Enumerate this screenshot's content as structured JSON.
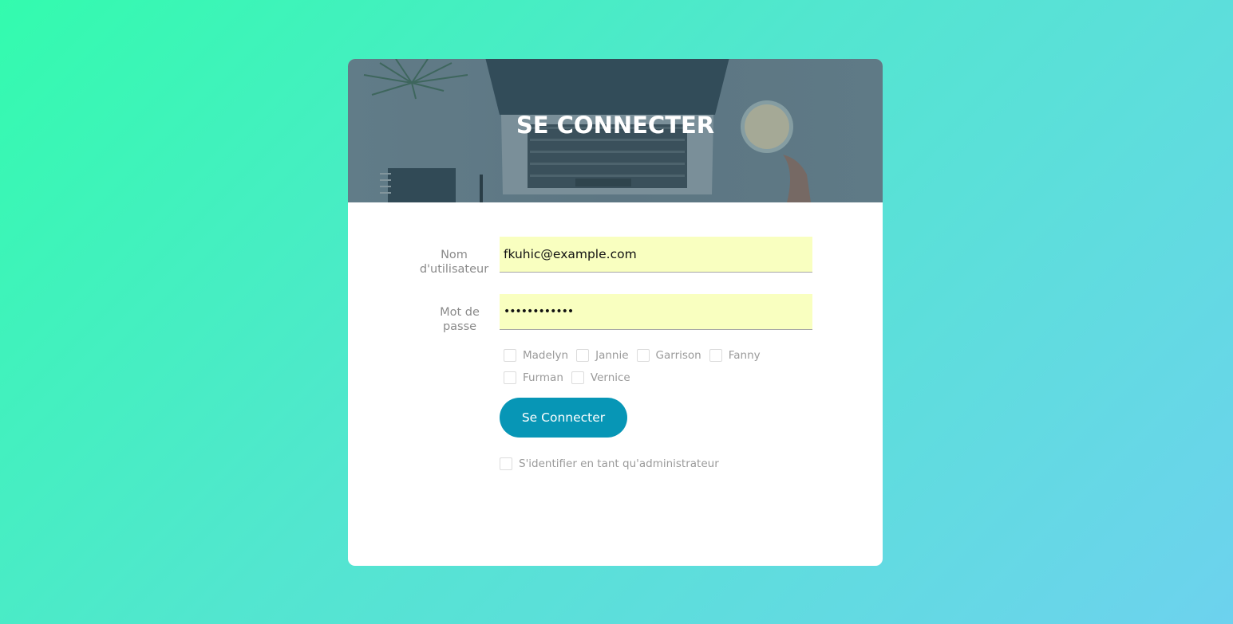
{
  "login": {
    "title": "SE CONNECTER",
    "username_label_line1": "Nom",
    "username_label_line2": "d'utilisateur",
    "username_value": "fkuhic@example.com",
    "password_label_line1": "Mot de",
    "password_label_line2": "passe",
    "password_value": "••••••••••••",
    "checkboxes_row1": [
      "Madelyn",
      "Jannie",
      "Garrison",
      "Fanny"
    ],
    "checkboxes_row2": [
      "Furman",
      "Vernice"
    ],
    "submit_label": "Se Connecter",
    "admin_label": "S'identifier en tant qu'administrateur"
  },
  "colors": {
    "button": "#0796b6",
    "input_autofill": "#f9ffc0",
    "background_start": "#33fbae",
    "background_end": "#6dd2ee"
  },
  "icons": {
    "hero_image": "desk-laptop-coffee-photo"
  }
}
